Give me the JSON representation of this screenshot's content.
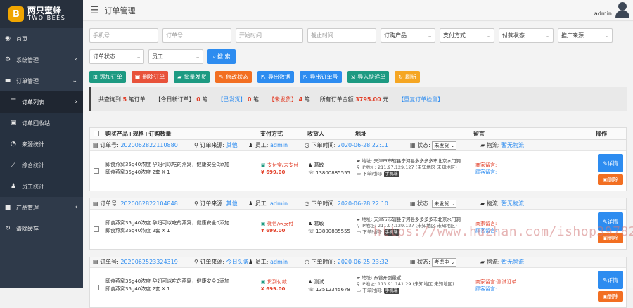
{
  "brand": {
    "name_cn": "两只蜜蜂",
    "name_en": "TWO BEES",
    "mark": "B"
  },
  "sidebar": {
    "items": [
      {
        "label": "首页",
        "icon": "gauge-icon"
      },
      {
        "label": "系统管理",
        "icon": "gear-icon",
        "arrow": "‹"
      },
      {
        "label": "订单管理",
        "icon": "cart-icon",
        "arrow": "⌄"
      },
      {
        "label": "订单列表",
        "icon": "list-icon",
        "arrow": "›"
      },
      {
        "label": "订单回收站",
        "icon": "trash-icon"
      },
      {
        "label": "来源统计",
        "icon": "pie-chart-icon"
      },
      {
        "label": "综合统计",
        "icon": "line-chart-icon"
      },
      {
        "label": "员工统计",
        "icon": "user-icon"
      },
      {
        "label": "产品管理",
        "icon": "cubes-icon",
        "arrow": "‹"
      },
      {
        "label": "清除缓存",
        "icon": "refresh-icon"
      }
    ]
  },
  "topbar": {
    "title": "订单管理",
    "user": "admin"
  },
  "filters": {
    "phone": "手机号",
    "order_no": "订单号",
    "start_time": "开始时间",
    "end_time": "截止时间",
    "product": "订购产品",
    "payment": "支付方式",
    "status": "付款状态",
    "source": "推广来源",
    "order_status": "订单状态",
    "staff": "员工",
    "search": "搜 索"
  },
  "actions": [
    {
      "label": "添加订单",
      "color": "#1d9a82",
      "icon": "plus-icon",
      "glyph": "⊞"
    },
    {
      "label": "删除订单",
      "color": "#e8523a",
      "icon": "trash-icon",
      "glyph": "▣"
    },
    {
      "label": "批量发货",
      "color": "#1d9a82",
      "icon": "truck-icon",
      "glyph": "▰"
    },
    {
      "label": "修改状态",
      "color": "#f26f22",
      "icon": "edit-icon",
      "glyph": "✎"
    },
    {
      "label": "导出数据",
      "color": "#2d8cf0",
      "icon": "export-icon",
      "glyph": "⇱"
    },
    {
      "label": "导出订单号",
      "color": "#2d8cf0",
      "icon": "export-icon",
      "glyph": "⇱"
    },
    {
      "label": "导入快递单",
      "color": "#1d9a82",
      "icon": "import-icon",
      "glyph": "⇲"
    },
    {
      "label": "刷新",
      "color": "#f5a623",
      "icon": "refresh-icon",
      "glyph": "↻"
    }
  ],
  "stats": {
    "total_prefix": "共查询到",
    "total_count": "5",
    "total_suffix": "笔订单",
    "today_label": "【今日新订单】",
    "today_count": "0",
    "today_unit": "笔",
    "shipped_label": "【已发货】",
    "shipped_count": "0",
    "shipped_unit": "笔",
    "unshipped_label": "【未发货】",
    "unshipped_count": "4",
    "unshipped_unit": "笔",
    "amount_label": "所有订单金额",
    "amount": "3795.00",
    "amount_unit": "元",
    "dup_check": "【重复订单检测】"
  },
  "table": {
    "headers": [
      "购买产品+规格+订购数量",
      "支付方式",
      "收货人",
      "地址",
      "留言",
      "操作"
    ],
    "labels": {
      "order_no": "订单号:",
      "source": "订单来源:",
      "staff": "员工:",
      "time": "下单时间:",
      "status": "状态:",
      "logistics": "物流:",
      "addr": "地址:",
      "ip": "IP地址:",
      "order_time": "下单时间:",
      "detail": "详情",
      "delete": "删除"
    },
    "orders": [
      {
        "order_no": "2020062822110880",
        "source": "其他",
        "staff": "admin",
        "time": "2020-06-28 22:11",
        "status": "未发货",
        "logistics": "暂无物流",
        "products": [
          "即食燕窝35g40浓度 孕妇可以吃的燕窝，健康安全0添加",
          "即食燕窝35g40浓度 2套 X 1"
        ],
        "pay_method": "支付宝/未支付",
        "pay_icon": "alipay-icon",
        "amount": "¥ 699.00",
        "receiver": "葛敏",
        "phone": "13800885555",
        "address": "天津市市辖县宁河县多多多多市北京水门洞",
        "ip": "211.97.129.127 (未知地区 未知地区)",
        "order_time_tag": "手机端",
        "note1": "商家留言:",
        "note2": "顾客留言:"
      },
      {
        "order_no": "2020062822104848",
        "source": "其他",
        "staff": "admin",
        "time": "2020-06-28 22:10",
        "status": "未发货",
        "logistics": "暂无物流",
        "products": [
          "即食燕窝35g40浓度 孕妇可以吃的燕窝，健康安全0添加",
          "即食燕窝35g40浓度 2套 X 1"
        ],
        "pay_method": "微信/未支付",
        "pay_icon": "wechat-icon",
        "amount": "¥ 699.00",
        "receiver": "葛敏",
        "phone": "13800885555",
        "address": "天津市市辖县宁河县多多多多市北京水门洞",
        "ip": "211.97.129.127 (未知地区 未知地区)",
        "order_time_tag": "手机端",
        "note1": "商家留言:",
        "note2": "顾客留言:"
      },
      {
        "order_no": "2020062523324319",
        "source": "今日头条",
        "staff": "admin",
        "time": "2020-06-25 23:32",
        "status": "考虑中",
        "logistics": "暂无物流",
        "products": [
          "即食燕窝35g40浓度 孕妇可以吃的燕窝，健康安全0添加",
          "即食燕窝35g40浓度 2套 X 1"
        ],
        "pay_method": "货到付款",
        "pay_icon": "truck-icon",
        "amount": "¥ 699.00",
        "receiver": "测试",
        "phone": "13512345678",
        "address": "东营开到最近",
        "ip": "113.91.141.29 (未知地区 未知地区)",
        "order_time_tag": "手机端",
        "note1": "商家留言:测试订单",
        "note2": "顾客留言:"
      }
    ]
  },
  "watermark": "https://www.huzhan.com/ishop39782"
}
